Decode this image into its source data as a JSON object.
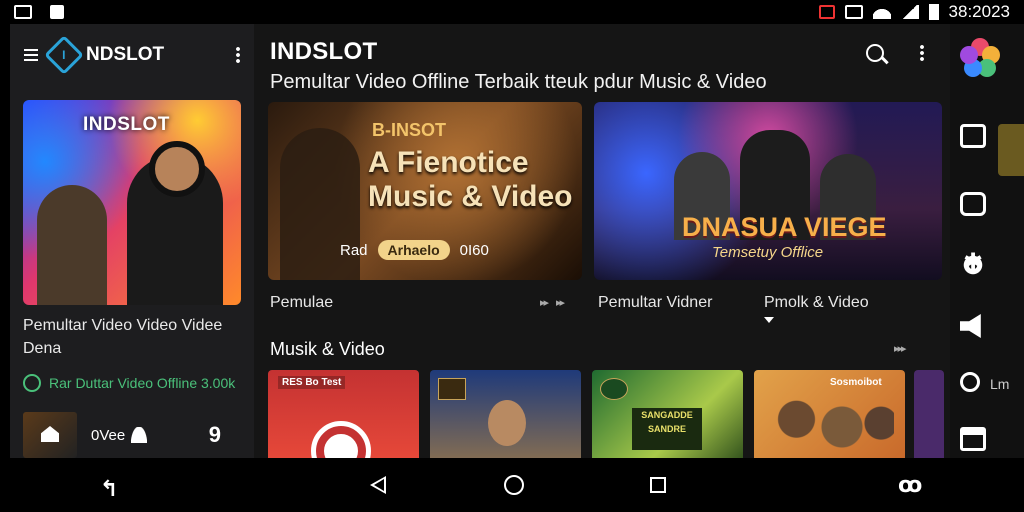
{
  "status_bar": {
    "time": "38:2023"
  },
  "drawer": {
    "logo_text": "NDSLOT",
    "logo_mark": "I",
    "hero_title": "INDSLOT",
    "description": "Pemultar Video Video Videe Dena",
    "meta_text": "Rar Duttar Video Offline 3.00k",
    "bottom_text": "0Vee",
    "bottom_number": "9"
  },
  "main": {
    "title": "INDSLOT",
    "subtitle": "Pemultar Video Offline Terbaik tteuk pdur Music & Video",
    "feature1": {
      "brand": "B-INSOT",
      "headline_line1": "A Fienotice",
      "headline_line2": "Music & Video",
      "left_text": "Rad",
      "pill": "Arhaelo",
      "right_text": "0I60",
      "caption": "Pemulae"
    },
    "feature2": {
      "title": "DNASUA VIEGE",
      "subtitle": "Temsetuy Offlice",
      "caption_left": "Pemultar Vidner",
      "caption_right": "Pmolk & Video"
    },
    "section_title": "Musik & Video",
    "cards": [
      {
        "label": "RES Bo Test"
      },
      {
        "label": ""
      },
      {
        "label": "SANGADDE SANDRE"
      },
      {
        "label": "Sosmoibot"
      }
    ]
  },
  "rail": {
    "text": "Lm",
    "logo_colors": [
      "#e94a6a",
      "#f3b03a",
      "#4ac07a",
      "#3a8aff",
      "#a04ae0"
    ]
  },
  "icons": {
    "status": [
      "gallery-icon",
      "notification-icon"
    ],
    "nav": [
      "back-icon",
      "triangle-back-icon",
      "home-icon",
      "recents-icon",
      "assistant-icon"
    ]
  }
}
